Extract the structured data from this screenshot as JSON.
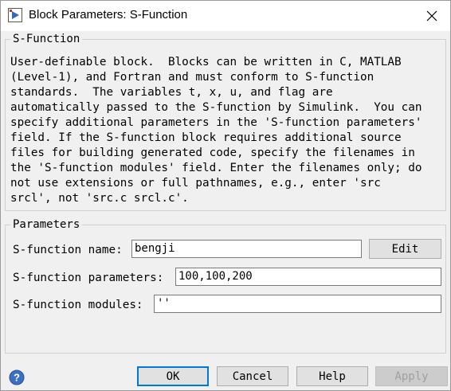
{
  "window": {
    "title": "Block Parameters: S-Function"
  },
  "sfunction_group": {
    "legend": "S-Function",
    "description_lines": [
      "User-definable block.  Blocks can be written in C, MATLAB",
      "(Level-1), and Fortran and must conform to S-function",
      "standards.  The variables t, x, u, and flag are",
      "automatically passed to the S-function by Simulink.  You can",
      "specify additional parameters in the 'S-function parameters'",
      "field. If the S-function block requires additional source",
      "files for building generated code, specify the filenames in",
      "the 'S-function modules' field. Enter the filenames only; do",
      "not use extensions or full pathnames, e.g., enter 'src",
      "srcl', not 'src.c srcl.c'."
    ]
  },
  "parameters_group": {
    "legend": "Parameters",
    "name_label": "S-function name:",
    "name_value": "bengji",
    "edit_label": "Edit",
    "params_label": "S-function parameters:",
    "params_value": "100,100,200",
    "modules_label": "S-function modules:",
    "modules_value": "''"
  },
  "buttons": {
    "ok": "OK",
    "cancel": "Cancel",
    "help": "Help",
    "apply": "Apply"
  },
  "icons": {
    "title": "simulink-block-icon",
    "close": "close-icon",
    "help": "help-icon"
  },
  "colors": {
    "accent": "#0078d7",
    "help_icon": "#3b6fc4"
  }
}
